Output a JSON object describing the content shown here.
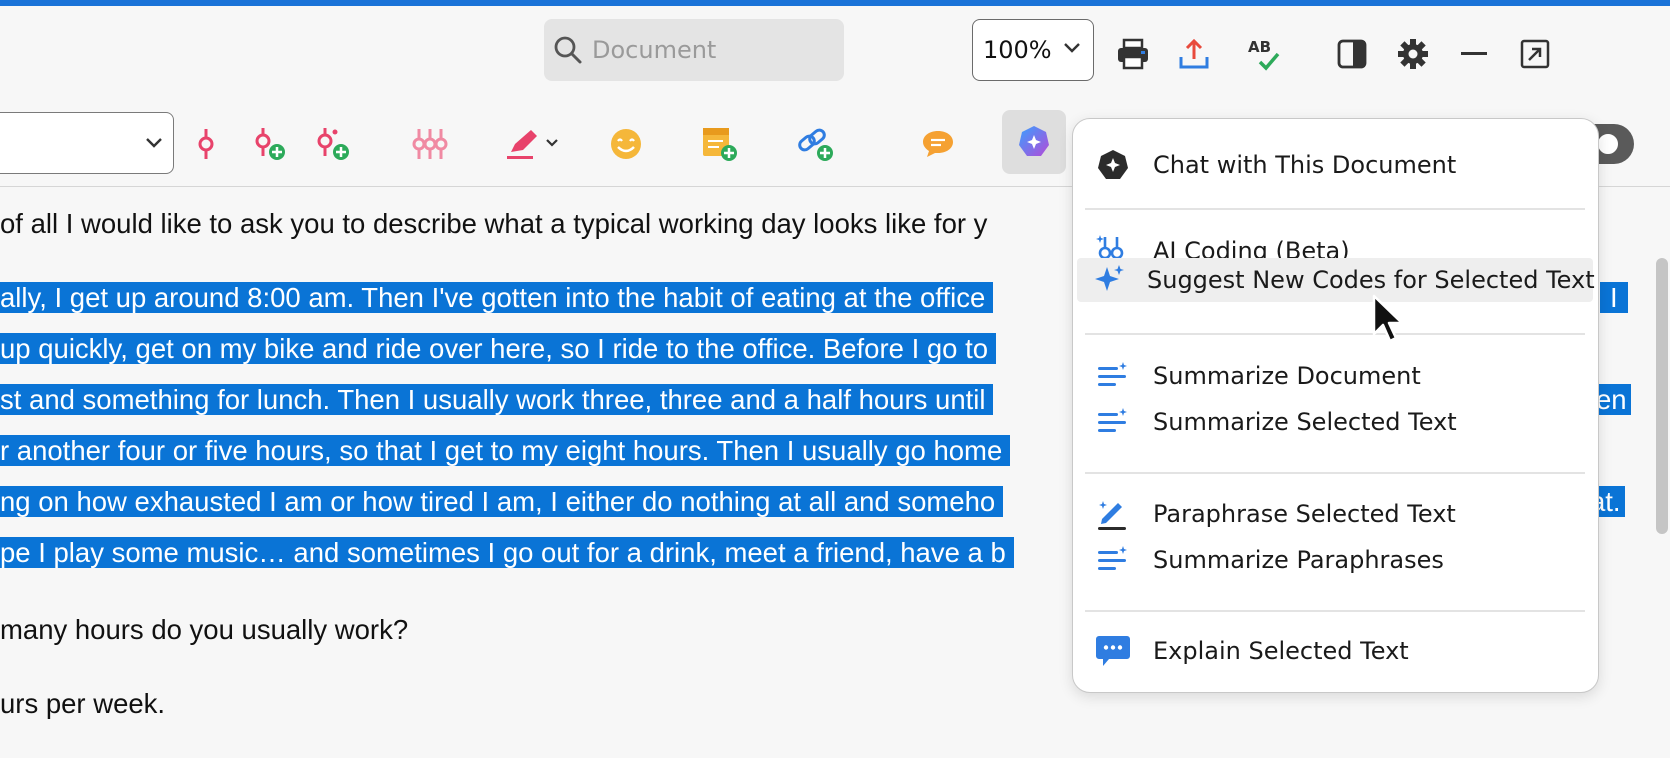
{
  "header": {
    "search_placeholder": "Document",
    "zoom_value": "100%",
    "icons": [
      "print-icon",
      "export-icon",
      "spellcheck-icon",
      "panel-icon",
      "settings-icon",
      "minimize-icon",
      "restore-icon"
    ]
  },
  "toolbar": {
    "icons": [
      "code-icon",
      "new-code-icon",
      "new-codes-icon",
      "multi-code-icon",
      "highlighter-icon",
      "emoji-icon",
      "memo-icon",
      "link-icon",
      "comment-icon",
      "ai-assist-icon"
    ]
  },
  "document": {
    "lines": [
      {
        "text": "of all I would like to ask you to describe what a typical working day looks like for y",
        "selected": false
      },
      {
        "text": "ally, I get up around 8:00 am. Then I've gotten into the habit of eating at the office",
        "selected": true,
        "tail": "I"
      },
      {
        "text": "up quickly, get on my bike and ride over here, so I ride to the office. Before I go to",
        "selected": true,
        "tail": ""
      },
      {
        "text": "st and something for lunch. Then I usually work three, three and a half hours until",
        "selected": true,
        "tail": "en"
      },
      {
        "text": "r another four or five hours, so that I get to my eight hours. Then I usually go home",
        "selected": true,
        "tail": ""
      },
      {
        "text": "ng on how exhausted I am or how tired I am, I either do nothing at all and someho",
        "selected": true,
        "tail": "at."
      },
      {
        "text": "pe I play some music… and sometimes I go out for a drink, meet a friend, have a b",
        "selected": true,
        "tail": ""
      },
      {
        "text": "many hours do you usually work?",
        "selected": false
      },
      {
        "text": "urs per week.",
        "selected": false
      }
    ]
  },
  "menu": {
    "groups": [
      [
        {
          "label": "Chat with This Document",
          "icon": "chat-document-icon"
        }
      ],
      [
        {
          "label": "AI Coding (Beta)",
          "icon": "ai-coding-icon"
        },
        {
          "label": "Suggest New Codes for Selected Text",
          "icon": "sparkle-icon",
          "highlighted": true
        }
      ],
      [
        {
          "label": "Summarize Document",
          "icon": "summarize-icon"
        },
        {
          "label": "Summarize Selected Text",
          "icon": "summarize-icon"
        }
      ],
      [
        {
          "label": "Paraphrase Selected Text",
          "icon": "paraphrase-icon"
        },
        {
          "label": "Summarize Paraphrases",
          "icon": "summarize-icon"
        }
      ],
      [
        {
          "label": "Explain Selected Text",
          "icon": "explain-icon"
        }
      ]
    ]
  },
  "colors": {
    "accent": "#1a73d8",
    "selection": "#0a74d6",
    "code_pink": "#e8436b",
    "icon_blue": "#2f7de1",
    "icon_orange": "#f2a532"
  }
}
